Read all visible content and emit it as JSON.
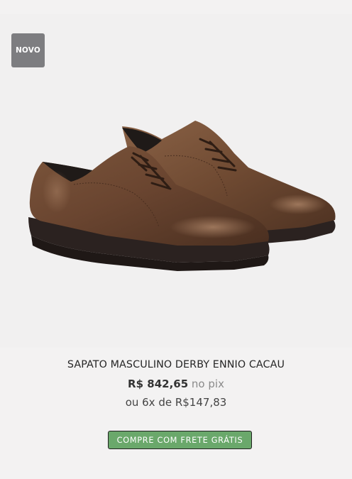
{
  "product": {
    "badge": "NOVO",
    "name": "SAPATO MASCULINO DERBY ENNIO CACAU",
    "price": "R$ 842,65",
    "price_suffix": "no pix",
    "installments": "ou 6x de R$147,83",
    "buy_label": "COMPRE COM FRETE GRÁTIS"
  },
  "colors": {
    "badge": "#7d7d80",
    "button": "#6aa86b",
    "leather": "#6e4a33",
    "sole": "#2b2220"
  }
}
